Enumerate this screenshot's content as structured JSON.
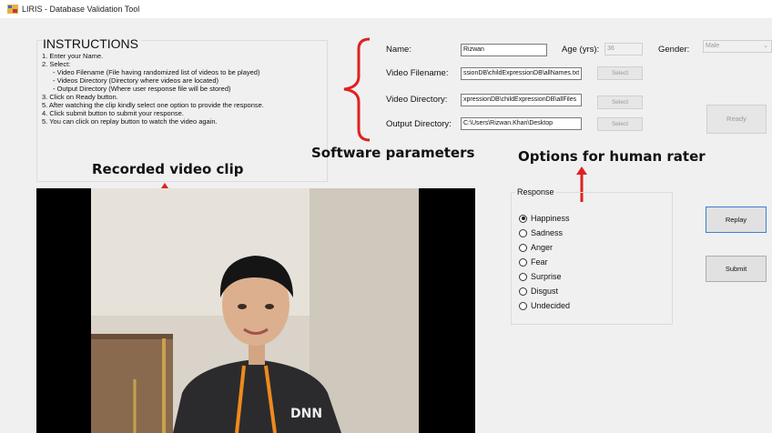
{
  "window": {
    "title": "LIRIS - Database Validation Tool"
  },
  "instructions": {
    "heading": "INSTRUCTIONS",
    "lines": [
      "1. Enter your Name.",
      "2. Select:",
      "    - Video Filename (File having randomized list of videos to be played)",
      "    - Videos Directory (Directory where videos are located)",
      "    - Output Directory (Where user response file will be stored)",
      "3. Click on Ready button.",
      "5. After watching the clip kindly select one option to provide the response.",
      "4. Click submit button to submit your response.",
      "5. You can click on replay button to watch the video again."
    ]
  },
  "params": {
    "name_label": "Name:",
    "name_value": "Rizwan",
    "age_label": "Age (yrs):",
    "age_value": "36",
    "gender_label": "Gender:",
    "gender_value": "Male",
    "video_filename_label": "Video Filename:",
    "video_filename_value": "ssionDB\\childExpressionDB\\allNames.txt",
    "video_directory_label": "Video Directory:",
    "video_directory_value": "xpressionDB\\childExpressionDB\\allFiles",
    "output_directory_label": "Output Directory:",
    "output_directory_value": "C:\\Users\\Rizwan.Khan\\Desktop",
    "select_label": "Select"
  },
  "buttons": {
    "ready": "Ready",
    "replay": "Replay",
    "submit": "Submit"
  },
  "response": {
    "legend": "Response",
    "options": [
      "Happiness",
      "Sadness",
      "Anger",
      "Fear",
      "Surprise",
      "Disgust",
      "Undecided"
    ],
    "selected": "Happiness"
  },
  "annotations": {
    "software_parameters": "Software parameters",
    "options_for_human_rater": "Options for human rater",
    "recorded_video_clip": "Recorded video clip"
  },
  "video": {
    "shirt_text": "DNN"
  },
  "colors": {
    "annotation_red": "#e02020",
    "accent_blue": "#3c7fd6",
    "window_bg": "#f0f0f0"
  }
}
